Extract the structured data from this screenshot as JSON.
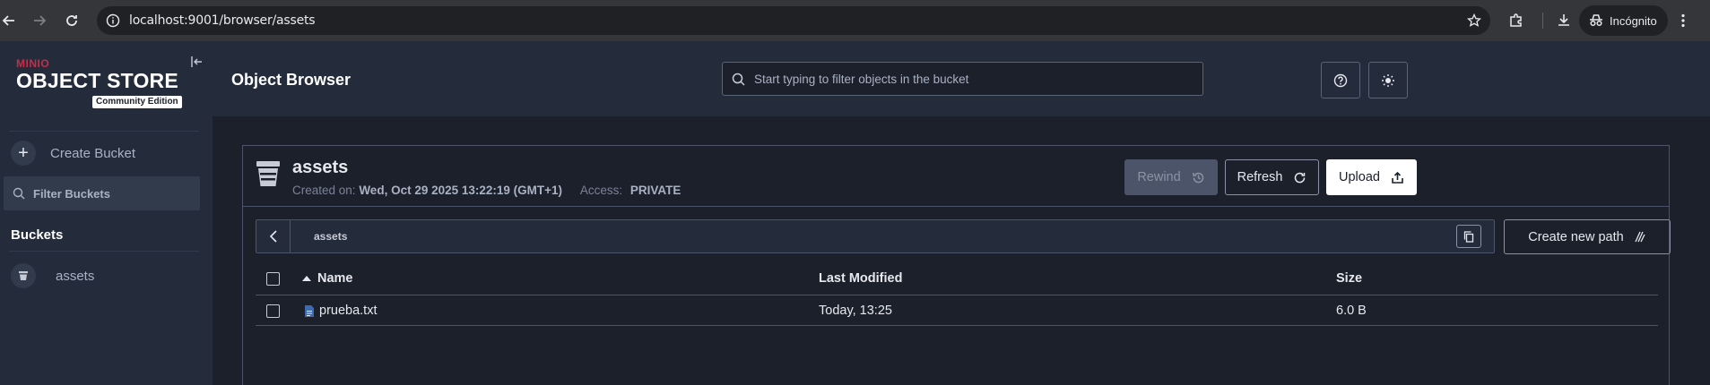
{
  "browser": {
    "url": "localhost:9001/browser/assets",
    "profile_label": "Incógnito"
  },
  "sidebar": {
    "brand_top": "MINIO",
    "brand_title": "OBJECT STORE",
    "brand_edition": "Community Edition",
    "create_bucket_label": "Create Bucket",
    "filter_placeholder": "Filter Buckets",
    "buckets_heading": "Buckets",
    "buckets": [
      {
        "label": "assets"
      }
    ]
  },
  "header": {
    "title": "Object Browser",
    "search_placeholder": "Start typing to filter objects in the bucket",
    "help_icon": "help-circle-icon",
    "theme_icon": "sun-icon"
  },
  "bucket": {
    "name": "assets",
    "created_label": "Created on:",
    "created_value": "Wed, Oct 29 2025 13:22:19 (GMT+1)",
    "access_label": "Access:",
    "access_value": "PRIVATE",
    "rewind_label": "Rewind",
    "refresh_label": "Refresh",
    "upload_label": "Upload"
  },
  "path": {
    "crumb": "assets",
    "create_new_path_label": "Create new path"
  },
  "table": {
    "columns": {
      "name": "Name",
      "last_modified": "Last Modified",
      "size": "Size"
    },
    "rows": [
      {
        "name": "prueba.txt",
        "last_modified": "Today, 13:25",
        "size": "6.0 B"
      }
    ]
  },
  "colors": {
    "background": "#1b202b",
    "sidebar": "#242c3b",
    "brand_red": "#c72c48"
  }
}
